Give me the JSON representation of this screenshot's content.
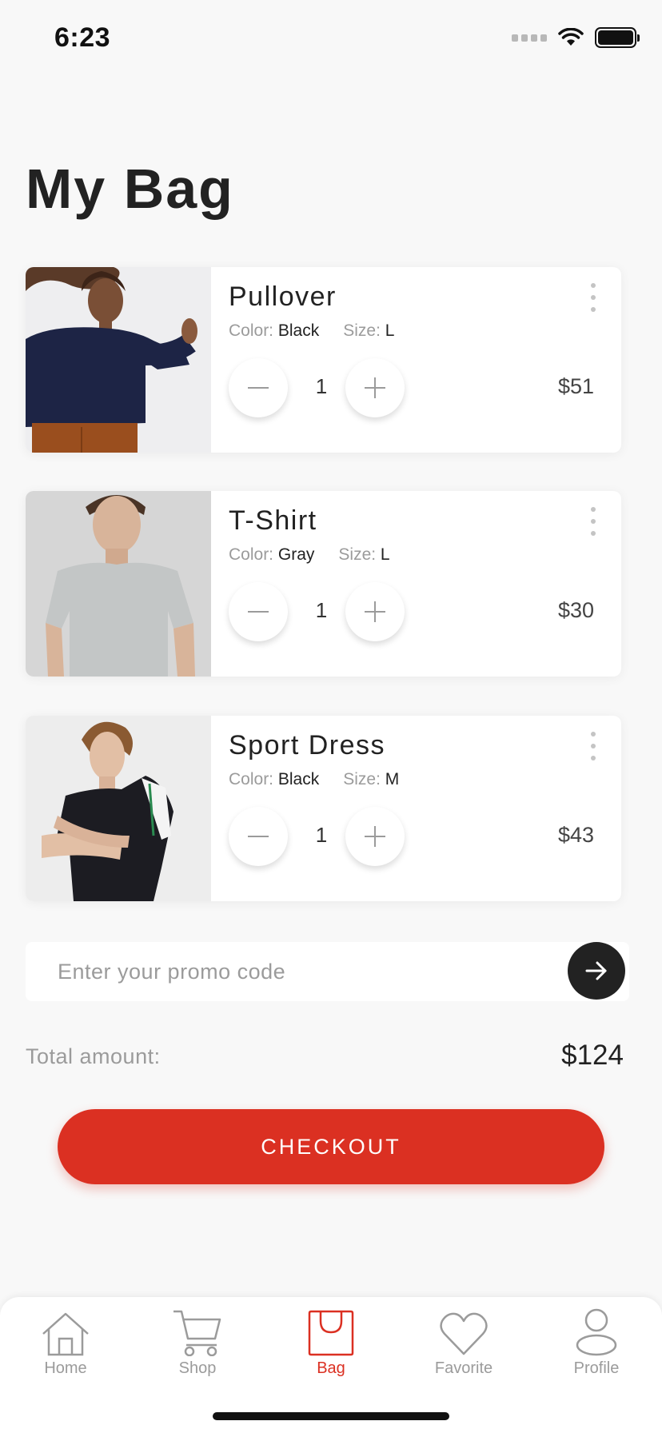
{
  "status": {
    "time": "6:23"
  },
  "page": {
    "title": "My Bag"
  },
  "attr_labels": {
    "color": "Color:",
    "size": "Size:"
  },
  "items": [
    {
      "name": "Pullover",
      "color": "Black",
      "size": "L",
      "quantity": "1",
      "price": "$51"
    },
    {
      "name": "T-Shirt",
      "color": "Gray",
      "size": "L",
      "quantity": "1",
      "price": "$30"
    },
    {
      "name": "Sport Dress",
      "color": "Black",
      "size": "M",
      "quantity": "1",
      "price": "$43"
    }
  ],
  "promo": {
    "placeholder": "Enter your promo code"
  },
  "total": {
    "label": "Total amount:",
    "value": "$124"
  },
  "checkout": {
    "label": "CHECKOUT"
  },
  "tabs": [
    {
      "label": "Home",
      "icon": "home-icon",
      "active": false
    },
    {
      "label": "Shop",
      "icon": "cart-icon",
      "active": false
    },
    {
      "label": "Bag",
      "icon": "bag-icon",
      "active": true
    },
    {
      "label": "Favorite",
      "icon": "heart-icon",
      "active": false
    },
    {
      "label": "Profile",
      "icon": "person-icon",
      "active": false
    }
  ],
  "colors": {
    "accent": "#db3022",
    "background": "#f8f8f8",
    "text": "#222222",
    "muted": "#9b9b9b"
  }
}
